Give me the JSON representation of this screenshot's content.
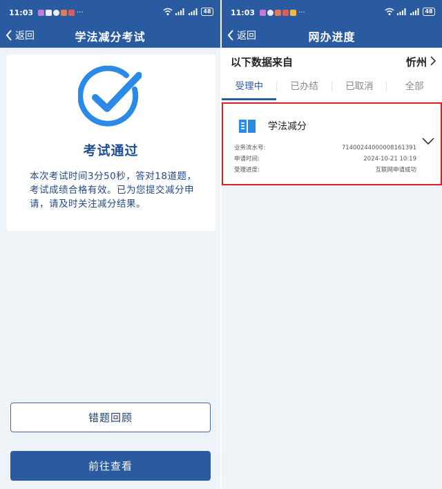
{
  "status_bar": {
    "time": "11:03",
    "battery": "48"
  },
  "left": {
    "nav": {
      "back_label": "返回",
      "title": "学法减分考试"
    },
    "result": {
      "title": "考试通过",
      "description": "本次考试时间3分50秒，答对18道题，考试成绩合格有效。已为您提交减分申请，请及时关注减分结果。"
    },
    "buttons": {
      "review_label": "错题回顾",
      "view_label": "前往查看"
    }
  },
  "right": {
    "nav": {
      "back_label": "返回",
      "title": "网办进度"
    },
    "source": {
      "label": "以下数据来自",
      "city": "忻州"
    },
    "tabs": [
      {
        "label": "受理中",
        "active": true
      },
      {
        "label": "已办结",
        "active": false
      },
      {
        "label": "已取消",
        "active": false
      },
      {
        "label": "全部",
        "active": false
      }
    ],
    "item": {
      "icon": "book-icon",
      "title": "学法减分",
      "rows": [
        {
          "key": "业务流水号:",
          "value": "71400244000008161391"
        },
        {
          "key": "申请时间:",
          "value": "2024-10-21 10:19"
        },
        {
          "key": "受理进度:",
          "value": "互联网申请成功"
        }
      ]
    }
  },
  "colors": {
    "primary": "#2a5ba0",
    "highlight_border": "#d92027",
    "check": "#2a8ae6",
    "page_bg": "#eef3f8"
  }
}
